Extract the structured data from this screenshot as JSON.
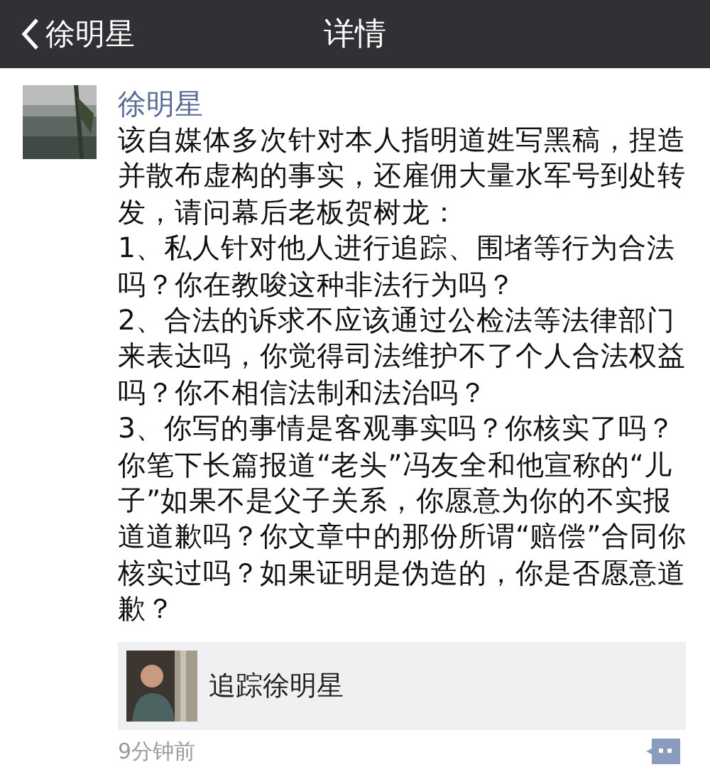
{
  "nav_bar": {
    "back_label": "徐明星",
    "title": "详情"
  },
  "post": {
    "author": "徐明星",
    "paragraphs": [
      "该自媒体多次针对本人指明道姓写黑稿，捏造并散布虚构的事实，还雇佣大量水军号到处转发，请问幕后老板贺树龙：",
      "1、私人针对他人进行追踪、围堵等行为合法吗？你在教唆这种非法行为吗？",
      "2、合法的诉求不应该通过公检法等法律部门来表达吗，你觉得司法维护不了个人合法权益吗？你不相信法制和法治吗？",
      "3、你写的事情是客观事实吗？你核实了吗？你笔下长篇报道“老头”冯友全和他宣称的“儿子”如果不是父子关系，你愿意为你的不实报道道歉吗？你文章中的那份所谓“赔偿”合同你核实过吗？如果证明是伪造的，你是否愿意道歉？"
    ],
    "link_card": {
      "title": "追踪徐明星"
    },
    "time": "9分钟前"
  }
}
